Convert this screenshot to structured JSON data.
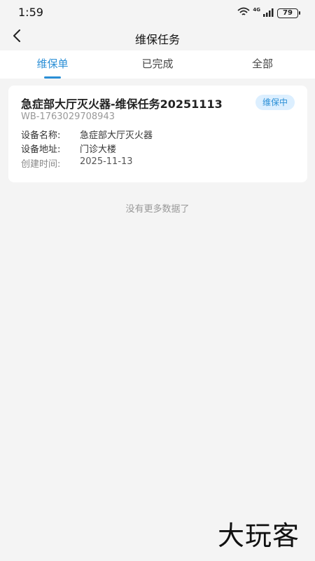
{
  "status_bar": {
    "time": "1:59",
    "network": "4G",
    "battery": "79"
  },
  "header": {
    "title": "维保任务",
    "back_icon": "chevron-left-icon"
  },
  "tabs": [
    {
      "label": "维保单",
      "active": true
    },
    {
      "label": "已完成",
      "active": false
    },
    {
      "label": "全部",
      "active": false
    }
  ],
  "task_card": {
    "title": "急症部大厅灭火器-维保任务20251113",
    "status": "维保中",
    "code": "WB-1763029708943",
    "device_name_label": "设备名称:",
    "device_name": "急症部大厅灭火器",
    "device_address_label": "设备地址:",
    "device_address": "门诊大楼",
    "created_label": "创建时间:",
    "created_time": "2025-11-13"
  },
  "list_footer": "没有更多数据了",
  "watermark": "大玩客",
  "colors": {
    "accent": "#2b8fd6",
    "badge_bg": "#dcefff",
    "page_bg": "#f4f4f4"
  }
}
